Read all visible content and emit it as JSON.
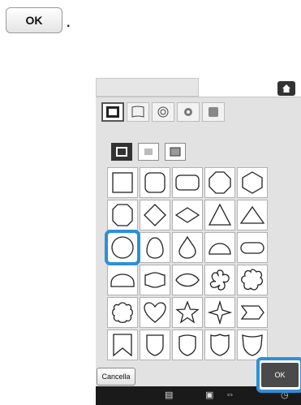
{
  "instruction": {
    "button_label": "OK",
    "period": "."
  },
  "panel": {
    "tabs": [
      {
        "name": "frame-tab-rect",
        "selected": true
      },
      {
        "name": "frame-tab-flag",
        "selected": false
      },
      {
        "name": "frame-tab-spiral",
        "selected": false
      },
      {
        "name": "frame-tab-flower",
        "selected": false
      },
      {
        "name": "frame-tab-fill",
        "selected": false
      }
    ],
    "styles": [
      "single-line",
      "fill",
      "double-line"
    ],
    "shapes": [
      "square",
      "rounded-square",
      "rounded-rect",
      "octagon",
      "hexagon",
      "octagon-flat",
      "diamond",
      "rhombus-wide",
      "triangle",
      "triangle-wide",
      "circle",
      "egg",
      "drop",
      "semicircle",
      "capsule",
      "arch",
      "tag",
      "leaf",
      "flower-5",
      "flower-scallop",
      "flower-scallop-2",
      "heart",
      "star",
      "four-point-star",
      "arrow-flag",
      "bookmark",
      "shield-1",
      "shield-2",
      "shield-3",
      "shield-4"
    ],
    "selected_shape_index": 10,
    "cancel_label": "Cancella",
    "ok_label": "OK"
  },
  "colors": {
    "highlight": "#2d8fd8"
  }
}
